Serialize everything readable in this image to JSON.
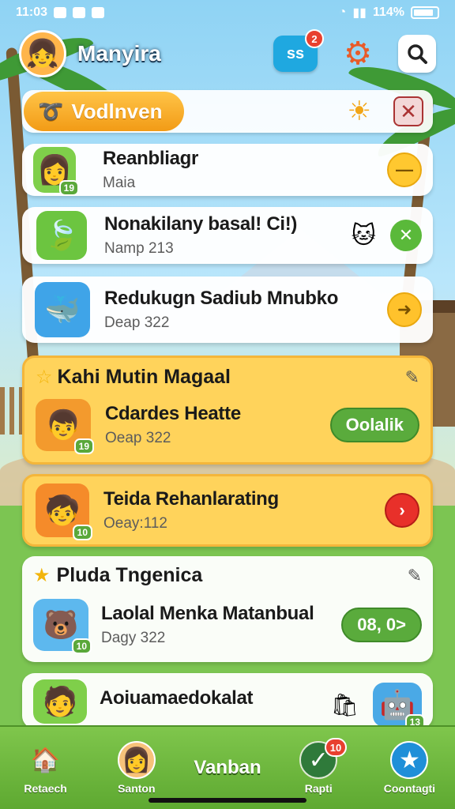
{
  "status_bar": {
    "time": "11:03",
    "battery_percent": "114%"
  },
  "header": {
    "username": "Manyira",
    "chat_button_label": "ss",
    "chat_badge": "2"
  },
  "banner": {
    "title": "Vodlnven"
  },
  "items": [
    {
      "title": "Reanbliagr",
      "subtitle": "Maia",
      "level": "19"
    },
    {
      "title": "Nonakilany basal! Ci!)",
      "subtitle": "Namp 213"
    },
    {
      "title": "Redukugn Sadiub Mnubko",
      "subtitle": "Deap 322"
    }
  ],
  "sections": [
    {
      "title": "Kahi Mutin Magaal",
      "item_title": "Cdardes Heatte",
      "item_subtitle": "Oeap 322",
      "level": "19",
      "button_label": "Oolalik"
    },
    {
      "item_title": "Teida Rehanlarating",
      "item_subtitle": "Oeay:112",
      "level": "10"
    },
    {
      "title": "Pluda Tngenica",
      "item_title": "Laolal Menka Matanbual",
      "item_subtitle": "Dagy 322",
      "level": "10",
      "button_label": "08, 0>"
    },
    {
      "item_title": "Aoiuamaedokalat",
      "level": "13"
    }
  ],
  "bottom_nav": {
    "items": [
      {
        "label": "Retaech"
      },
      {
        "label": "Santon"
      },
      {
        "label": "Vanban"
      },
      {
        "label": "Rapti",
        "badge": "10"
      },
      {
        "label": "Coontagti"
      }
    ]
  },
  "colors": {
    "accent_green": "#5aab3c",
    "accent_orange": "#f29b16",
    "accent_blue": "#1fa8e0",
    "alert_red": "#e8402f"
  }
}
